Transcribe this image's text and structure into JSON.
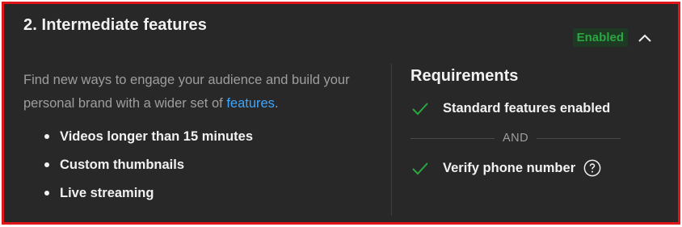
{
  "header": {
    "title": "2. Intermediate features",
    "status": "Enabled"
  },
  "description": {
    "text_before_link": "Find new ways to engage your audience and build your personal brand with a wider set of ",
    "link_text": "features",
    "text_after_link": "."
  },
  "features": [
    "Videos longer than 15 minutes",
    "Custom thumbnails",
    "Live streaming"
  ],
  "requirements": {
    "title": "Requirements",
    "items": [
      {
        "label": "Standard features enabled",
        "met": true
      },
      {
        "label": "Verify phone number",
        "met": true
      }
    ],
    "separator": "AND"
  },
  "icons": {
    "collapse": "chevron-up-icon",
    "check": "check-icon",
    "help": "help-circle-icon"
  },
  "colors": {
    "accent_link": "#3ea6ff",
    "success": "#2ba640",
    "frame_border": "#e0161a",
    "panel_bg": "#282828"
  }
}
